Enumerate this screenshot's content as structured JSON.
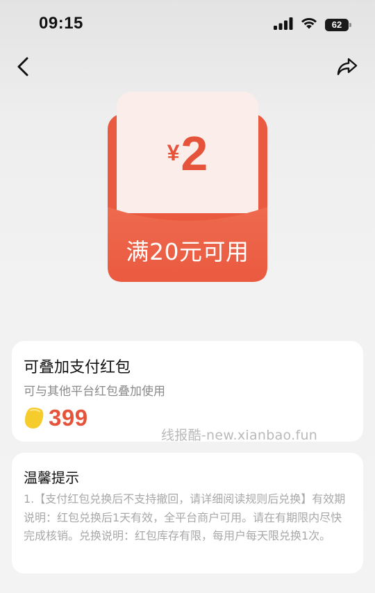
{
  "status_bar": {
    "time": "09:15",
    "battery": "62",
    "icons": [
      "cellular-signal-icon",
      "wifi-icon",
      "battery-icon"
    ]
  },
  "nav": {
    "back_icon": "chevron-left-icon",
    "share_icon": "share-arrow-icon"
  },
  "coupon": {
    "currency": "¥",
    "amount": "2",
    "condition": "满20元可用",
    "colors": {
      "envelope": "#e95a40",
      "paper": "#fbeeea",
      "amount_text": "#e4533a"
    }
  },
  "product": {
    "title": "可叠加支付红包",
    "description": "可与其他平台红包叠加使用",
    "price": "399",
    "price_icon": "gold-coin-icon",
    "price_color": "#e4533a"
  },
  "watermark": "线报酷-new.xianbao.fun",
  "tips": {
    "title": "温馨提示",
    "body": "1.【支付红包兑换后不支持撤回，请详细阅读规则后兑换】有效期说明：红包兑换后1天有效，全平台商户可用。请在有期限内尽快完成核销。兑换说明：红包库存有限，每用户每天限兑换1次。"
  }
}
